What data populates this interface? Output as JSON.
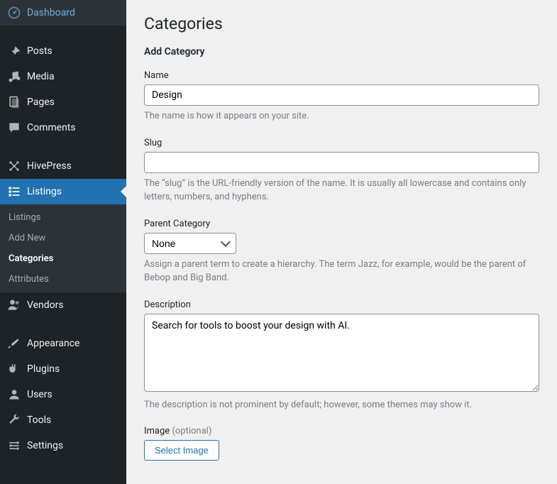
{
  "sidebar": {
    "items": [
      {
        "label": "Dashboard",
        "icon": "dashboard"
      },
      {
        "label": "Posts",
        "icon": "pin"
      },
      {
        "label": "Media",
        "icon": "music"
      },
      {
        "label": "Pages",
        "icon": "pages"
      },
      {
        "label": "Comments",
        "icon": "comment"
      },
      {
        "label": "HivePress",
        "icon": "hivepress"
      },
      {
        "label": "Listings",
        "icon": "listings",
        "active": true
      },
      {
        "label": "Vendors",
        "icon": "vendors"
      },
      {
        "label": "Appearance",
        "icon": "brush"
      },
      {
        "label": "Plugins",
        "icon": "plugin"
      },
      {
        "label": "Users",
        "icon": "user"
      },
      {
        "label": "Tools",
        "icon": "wrench"
      },
      {
        "label": "Settings",
        "icon": "settings"
      }
    ],
    "submenu": [
      {
        "label": "Listings"
      },
      {
        "label": "Add New"
      },
      {
        "label": "Categories",
        "active": true
      },
      {
        "label": "Attributes"
      }
    ]
  },
  "main": {
    "page_title": "Categories",
    "section_title": "Add Category",
    "name": {
      "label": "Name",
      "value": "Design",
      "help": "The name is how it appears on your site."
    },
    "slug": {
      "label": "Slug",
      "value": "",
      "help": "The “slug” is the URL-friendly version of the name. It is usually all lowercase and contains only letters, numbers, and hyphens."
    },
    "parent": {
      "label": "Parent Category",
      "selected": "None",
      "help": "Assign a parent term to create a hierarchy. The term Jazz, for example, would be the parent of Bebop and Big Band."
    },
    "description": {
      "label": "Description",
      "value": "Search for tools to boost your design with AI.",
      "help": "The description is not prominent by default; however, some themes may show it."
    },
    "image": {
      "label": "Image ",
      "optional": "(optional)",
      "button": "Select Image"
    }
  }
}
